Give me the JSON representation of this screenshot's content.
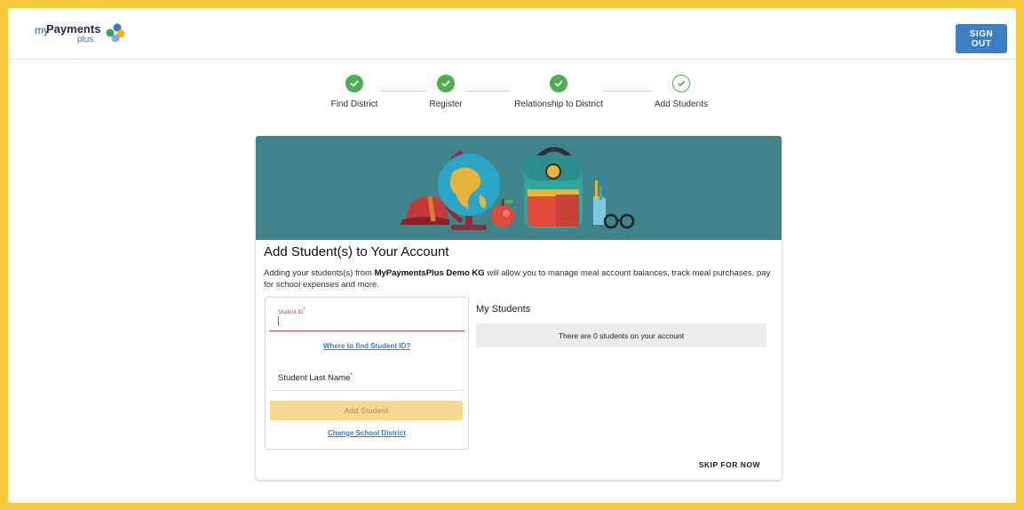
{
  "header": {
    "logo": {
      "prefix": "my",
      "brand": "Payments",
      "suffix": "plus"
    },
    "sign_out_label": "SIGN OUT"
  },
  "stepper": {
    "steps": [
      {
        "label": "Find District",
        "status": "complete"
      },
      {
        "label": "Register",
        "status": "complete"
      },
      {
        "label": "Relationship to District",
        "status": "complete"
      },
      {
        "label": "Add Students",
        "status": "current"
      }
    ]
  },
  "card": {
    "title": "Add Student(s) to Your Account",
    "description_before": "Adding your students(s) from ",
    "district_name": "MyPaymentsPlus Demo KG",
    "description_after": " will allow you to manage meal account balances, track meal purchases, pay for school expenses and more.",
    "form": {
      "student_id_label": "Student ID",
      "required_mark": "*",
      "find_id_link": "Where to find Student ID?",
      "last_name_label": "Student Last Name",
      "add_button_label": "Add Student",
      "change_district_link": "Change School District"
    },
    "my_students": {
      "title": "My Students",
      "empty_message": "There are 0 students on your account"
    },
    "skip_label": "SKIP FOR NOW"
  },
  "colors": {
    "frame": "#f8c93b",
    "primary": "#3b7fc4",
    "success": "#4caf50",
    "banner": "#3f838b",
    "error": "#d23b4b",
    "disabled_button": "#f6d98f"
  }
}
